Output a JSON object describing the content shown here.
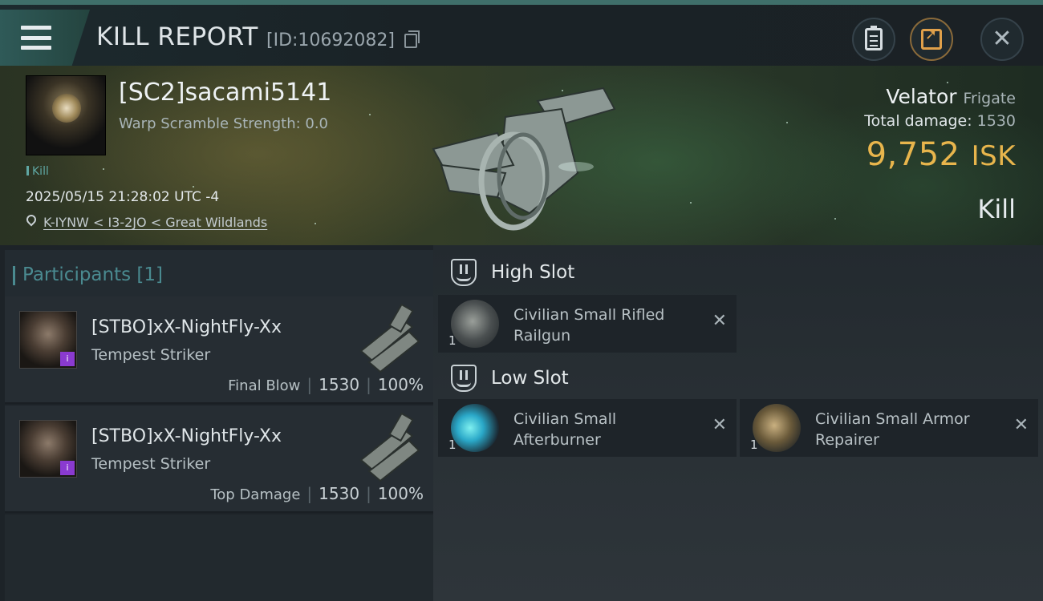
{
  "header": {
    "title": "KILL REPORT",
    "report_id": "[ID:10692082]",
    "icons": [
      "menu-icon",
      "copy-icon",
      "clipboard-icon",
      "share-icon",
      "close-icon"
    ],
    "close_glyph": "✕"
  },
  "victim": {
    "name": "[SC2]sacami5141",
    "warp_scramble": "Warp Scramble Strength: 0.0",
    "kill_tag": "Kill",
    "datetime": "2025/05/15 21:28:02 UTC -4",
    "location": "K-IYNW < I3-2JO < Great Wildlands"
  },
  "ship": {
    "name": "Velator",
    "class": "Frigate",
    "total_damage_label": "Total damage:",
    "total_damage_value": "1530",
    "isk_value": "9,752",
    "isk_unit": "ISK",
    "result": "Kill"
  },
  "participants": {
    "title": "Participants [1]",
    "rows": [
      {
        "name": "[STBO]xX-NightFly-Xx",
        "ship": "Tempest Striker",
        "tag": "Final Blow",
        "damage": "1530",
        "percent": "100%"
      },
      {
        "name": "[STBO]xX-NightFly-Xx",
        "ship": "Tempest Striker",
        "tag": "Top Damage",
        "damage": "1530",
        "percent": "100%"
      }
    ]
  },
  "fittings": {
    "high_slot": {
      "title": "High Slot",
      "modules": [
        {
          "name": "Civilian Small Rifled Railgun",
          "qty": "1"
        }
      ]
    },
    "low_slot": {
      "title": "Low Slot",
      "modules": [
        {
          "name": "Civilian Small Afterburner",
          "qty": "1"
        },
        {
          "name": "Civilian Small Armor Repairer",
          "qty": "1"
        }
      ]
    },
    "remove_glyph": "✕"
  },
  "colors": {
    "accent_teal": "#4a8a90",
    "isk_gold": "#e8b54c",
    "badge_purple": "#8a3ad0"
  }
}
